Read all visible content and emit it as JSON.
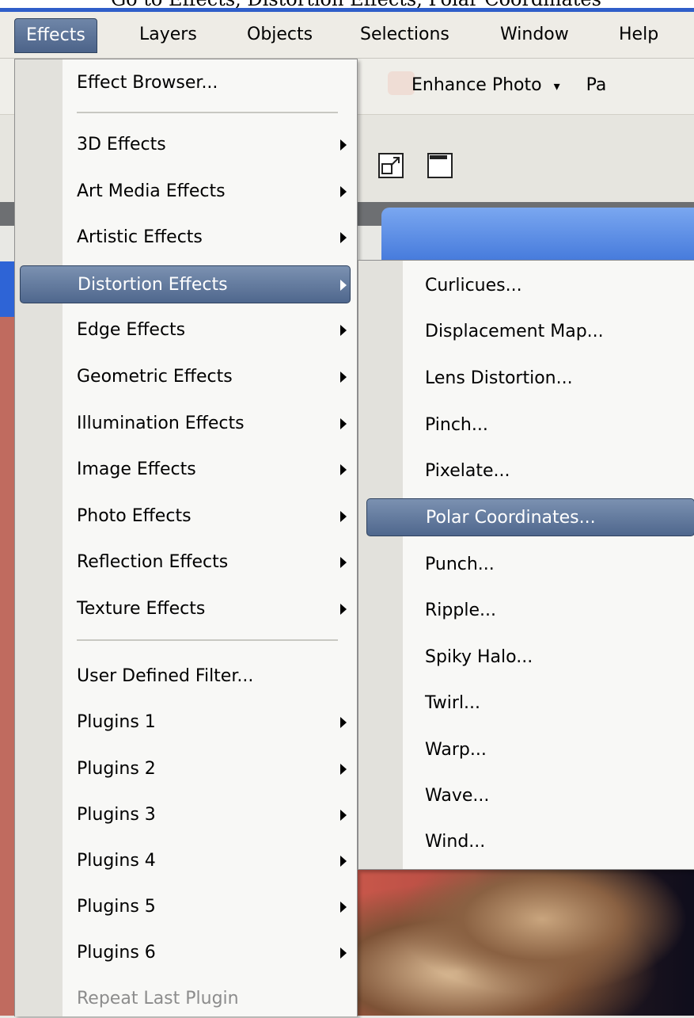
{
  "caption_text": "Go to Effects, Distortion Effects, Polar Coordinates",
  "menubar": {
    "items": [
      {
        "label": "Effects"
      },
      {
        "label": "Layers"
      },
      {
        "label": "Objects"
      },
      {
        "label": "Selections"
      },
      {
        "label": "Window"
      },
      {
        "label": "Help"
      }
    ]
  },
  "toolbar": {
    "enhance_label": "Enhance Photo",
    "enhance_arrow": "▾",
    "partial_label": "Pa"
  },
  "effects_menu": {
    "items": [
      {
        "label": "Effect Browser..."
      },
      {
        "label": "3D Effects"
      },
      {
        "label": "Art Media Effects"
      },
      {
        "label": "Artistic Effects"
      },
      {
        "label": "Distortion Effects"
      },
      {
        "label": "Edge Effects"
      },
      {
        "label": "Geometric Effects"
      },
      {
        "label": "Illumination Effects"
      },
      {
        "label": "Image Effects"
      },
      {
        "label": "Photo Effects"
      },
      {
        "label": "Reflection Effects"
      },
      {
        "label": "Texture Effects"
      },
      {
        "label": "User Defined Filter..."
      },
      {
        "label": "Plugins 1"
      },
      {
        "label": "Plugins 2"
      },
      {
        "label": "Plugins 3"
      },
      {
        "label": "Plugins 4"
      },
      {
        "label": "Plugins 5"
      },
      {
        "label": "Plugins 6"
      },
      {
        "label": "Repeat Last Plugin"
      }
    ],
    "highlighted": "Distortion Effects"
  },
  "distortion_submenu": {
    "items": [
      {
        "label": "Curlicues..."
      },
      {
        "label": "Displacement Map..."
      },
      {
        "label": "Lens Distortion..."
      },
      {
        "label": "Pinch..."
      },
      {
        "label": "Pixelate..."
      },
      {
        "label": "Polar Coordinates..."
      },
      {
        "label": "Punch..."
      },
      {
        "label": "Ripple..."
      },
      {
        "label": "Spiky Halo..."
      },
      {
        "label": "Twirl..."
      },
      {
        "label": "Warp..."
      },
      {
        "label": "Wave..."
      },
      {
        "label": "Wind..."
      }
    ],
    "highlighted": "Polar Coordinates..."
  },
  "colors": {
    "highlight": "#5a7198",
    "menu_bg": "#f8f8f6",
    "gutter": "#e2e1dc",
    "title_blue": "#2f5ec9"
  }
}
